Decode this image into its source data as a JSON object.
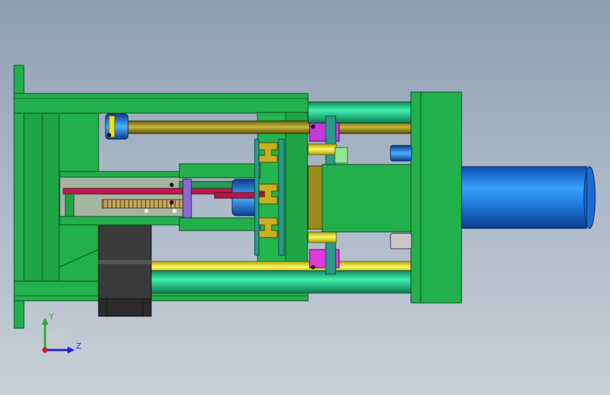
{
  "view": {
    "background_top": "#8e9fb2",
    "background_bottom": "#c9d0d8"
  },
  "colors": {
    "frame_green": "#22b04c",
    "frame_dark": "#0f7a30",
    "rod_teal": "#1fc28a",
    "cylinder_blue": "#1f7de0",
    "rod_yellow": "#e8e020",
    "rod_olive": "#9a8a1a",
    "magenta": "#c23ad8",
    "crimson": "#b01848",
    "motor_gray": "#3a3a3a",
    "rack_tan": "#c8a860"
  },
  "triad": {
    "y_label": "Y",
    "z_label": "Z",
    "y_color": "#20b020",
    "z_color": "#2020d8",
    "origin_color": "#d02020"
  }
}
